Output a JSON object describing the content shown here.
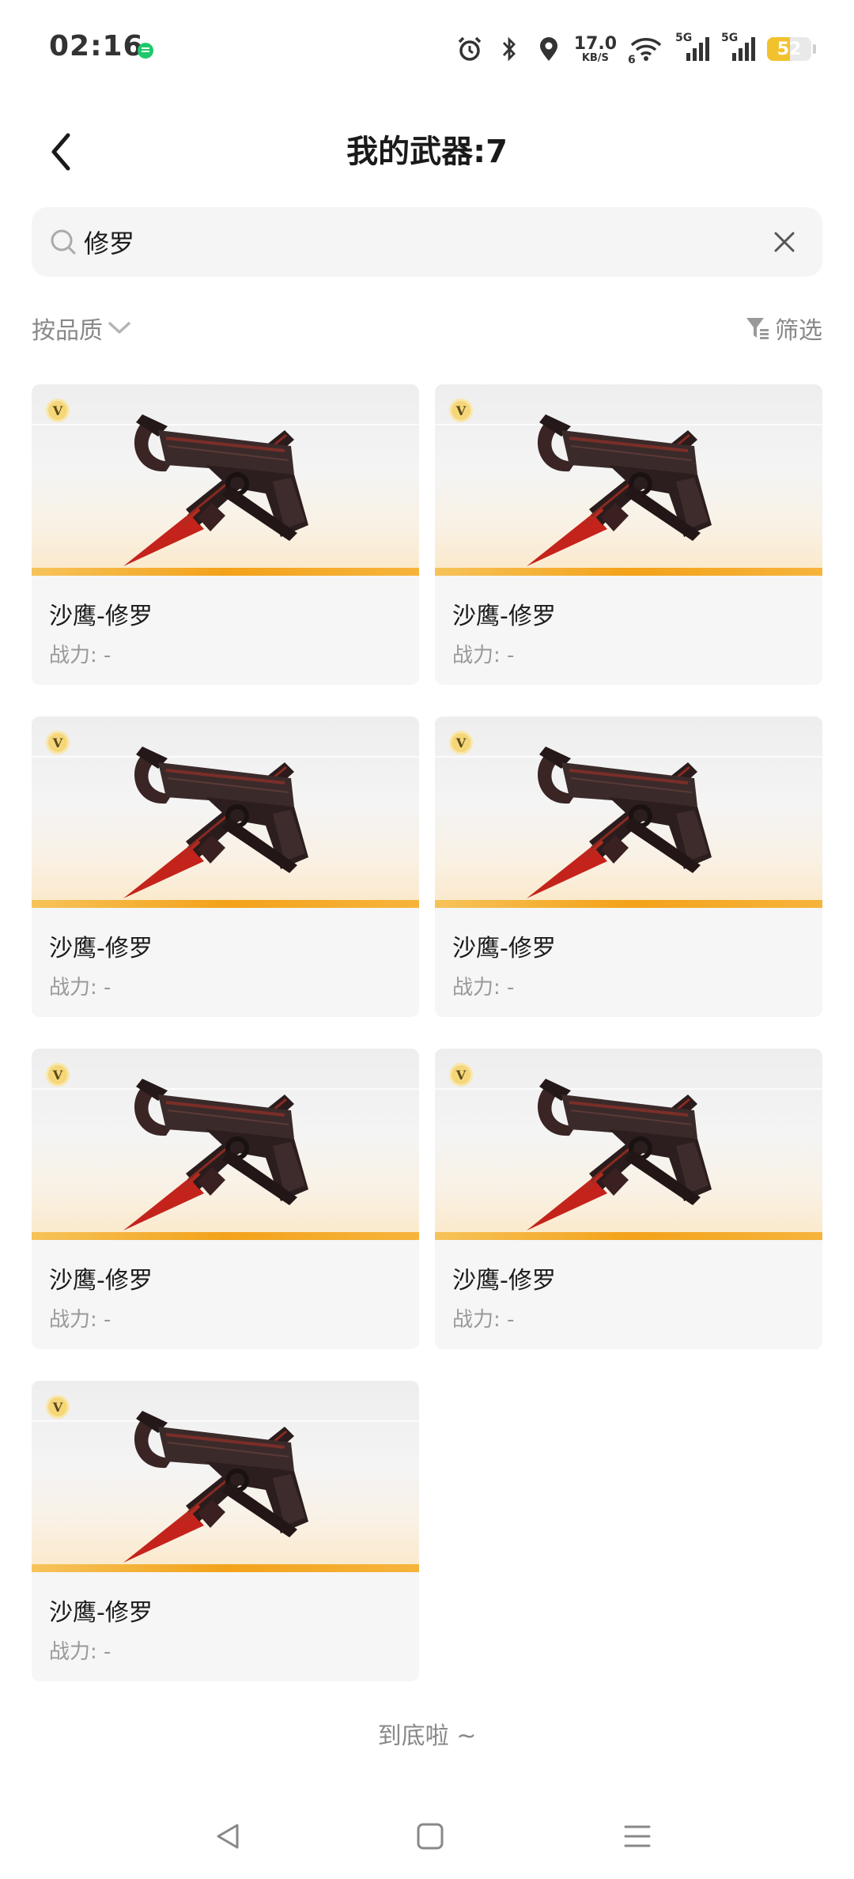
{
  "status_bar": {
    "time": "02:16",
    "speed_value": "17.0",
    "speed_unit": "KB/S",
    "network_1": "5G",
    "network_2": "5G",
    "wifi_sub": "6",
    "battery": "52",
    "battery_level": 0.52,
    "battery_color": "#f2c22e",
    "app_dot_color": "#1ec96b"
  },
  "header": {
    "title": "我的武器:7"
  },
  "search": {
    "value": "修罗",
    "placeholder": ""
  },
  "toolbar": {
    "sort_label": "按品质",
    "filter_label": "筛选"
  },
  "weapons": [
    {
      "name": "沙鹰-修罗",
      "power": "战力: -",
      "badge": "V"
    },
    {
      "name": "沙鹰-修罗",
      "power": "战力: -",
      "badge": "V"
    },
    {
      "name": "沙鹰-修罗",
      "power": "战力: -",
      "badge": "V"
    },
    {
      "name": "沙鹰-修罗",
      "power": "战力: -",
      "badge": "V"
    },
    {
      "name": "沙鹰-修罗",
      "power": "战力: -",
      "badge": "V"
    },
    {
      "name": "沙鹰-修罗",
      "power": "战力: -",
      "badge": "V"
    },
    {
      "name": "沙鹰-修罗",
      "power": "战力: -",
      "badge": "V"
    }
  ],
  "footer": {
    "end_text": "到底啦 ~"
  },
  "icons": {
    "status": [
      "alarm-icon",
      "bluetooth-icon",
      "location-icon",
      "wifi-icon",
      "signal-icon",
      "signal-icon",
      "battery-icon"
    ],
    "header": [
      "back-arrow-icon"
    ],
    "search": [
      "search-icon",
      "clear-icon"
    ],
    "toolbar": [
      "chevron-down-icon",
      "filter-icon"
    ],
    "nav": [
      "back-triangle-icon",
      "home-square-icon",
      "menu-lines-icon"
    ]
  }
}
